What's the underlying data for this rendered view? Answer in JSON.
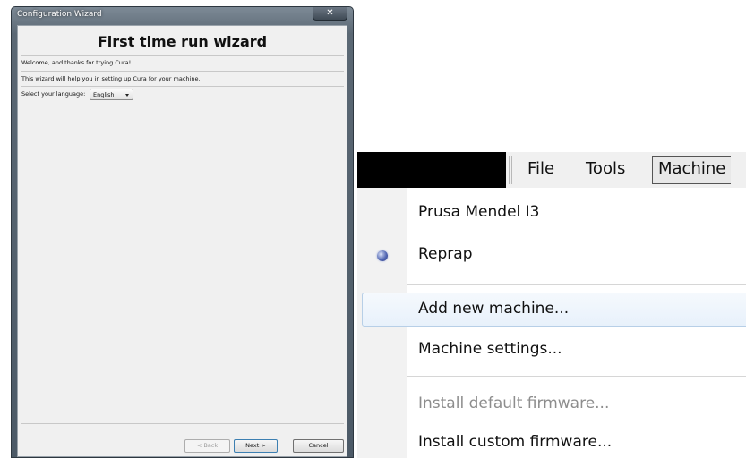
{
  "wizard": {
    "window_title": "Configuration Wizard",
    "close_glyph": "✕",
    "heading": "First time run wizard",
    "welcome_text": "Welcome, and thanks for trying Cura!",
    "help_text": "This wizard will help you in setting up Cura for your machine.",
    "language_label": "Select your language:",
    "language_value": "English",
    "buttons": {
      "back": "< Back",
      "next": "Next >",
      "cancel": "Cancel"
    }
  },
  "menu": {
    "menubar": [
      "File",
      "Tools",
      "Machine"
    ],
    "active_menu": "Machine",
    "items": [
      {
        "label": "Prusa Mendel I3",
        "enabled": true,
        "selected": false
      },
      {
        "label": "Reprap",
        "enabled": true,
        "selected": true
      },
      {
        "label": "Add new machine...",
        "enabled": true,
        "highlighted": true
      },
      {
        "label": "Machine settings...",
        "enabled": true
      },
      {
        "label": "Install default firmware...",
        "enabled": false
      },
      {
        "label": "Install custom firmware...",
        "enabled": true
      }
    ]
  },
  "colors": {
    "titlebar": "#5b6874",
    "menu_highlight_border": "#b7cfe7",
    "radio_dot": "#5469b4"
  }
}
